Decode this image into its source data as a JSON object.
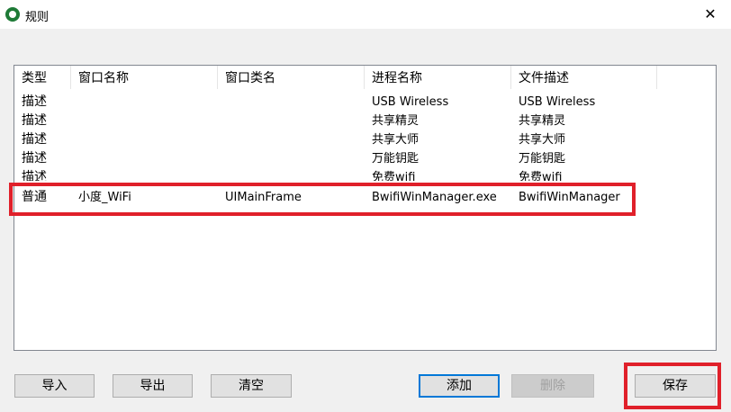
{
  "window": {
    "title": "规则",
    "close_glyph": "✕"
  },
  "columns": [
    "类型",
    "窗口名称",
    "窗口类名",
    "进程名称",
    "文件描述"
  ],
  "rows": [
    {
      "type": "描述",
      "window_name": "",
      "class_name": "",
      "process": "USB Wireless",
      "desc": "USB Wireless"
    },
    {
      "type": "描述",
      "window_name": "",
      "class_name": "",
      "process": "共享精灵",
      "desc": "共享精灵"
    },
    {
      "type": "描述",
      "window_name": "",
      "class_name": "",
      "process": "共享大师",
      "desc": "共享大师"
    },
    {
      "type": "描述",
      "window_name": "",
      "class_name": "",
      "process": "万能钥匙",
      "desc": "万能钥匙"
    },
    {
      "type": "描述",
      "window_name": "",
      "class_name": "",
      "process": "免费wifi",
      "desc": "免费wifi"
    },
    {
      "type": "普通",
      "window_name": "小度_WiFi",
      "class_name": "UIMainFrame",
      "process": "BwifiWinManager.exe",
      "desc": "BwifiWinManager"
    }
  ],
  "buttons": {
    "import": "导入",
    "export": "导出",
    "clear": "清空",
    "add": "添加",
    "delete": "删除",
    "save": "保存"
  },
  "colors": {
    "highlight": "#e0202a",
    "focus": "#0078d7"
  }
}
